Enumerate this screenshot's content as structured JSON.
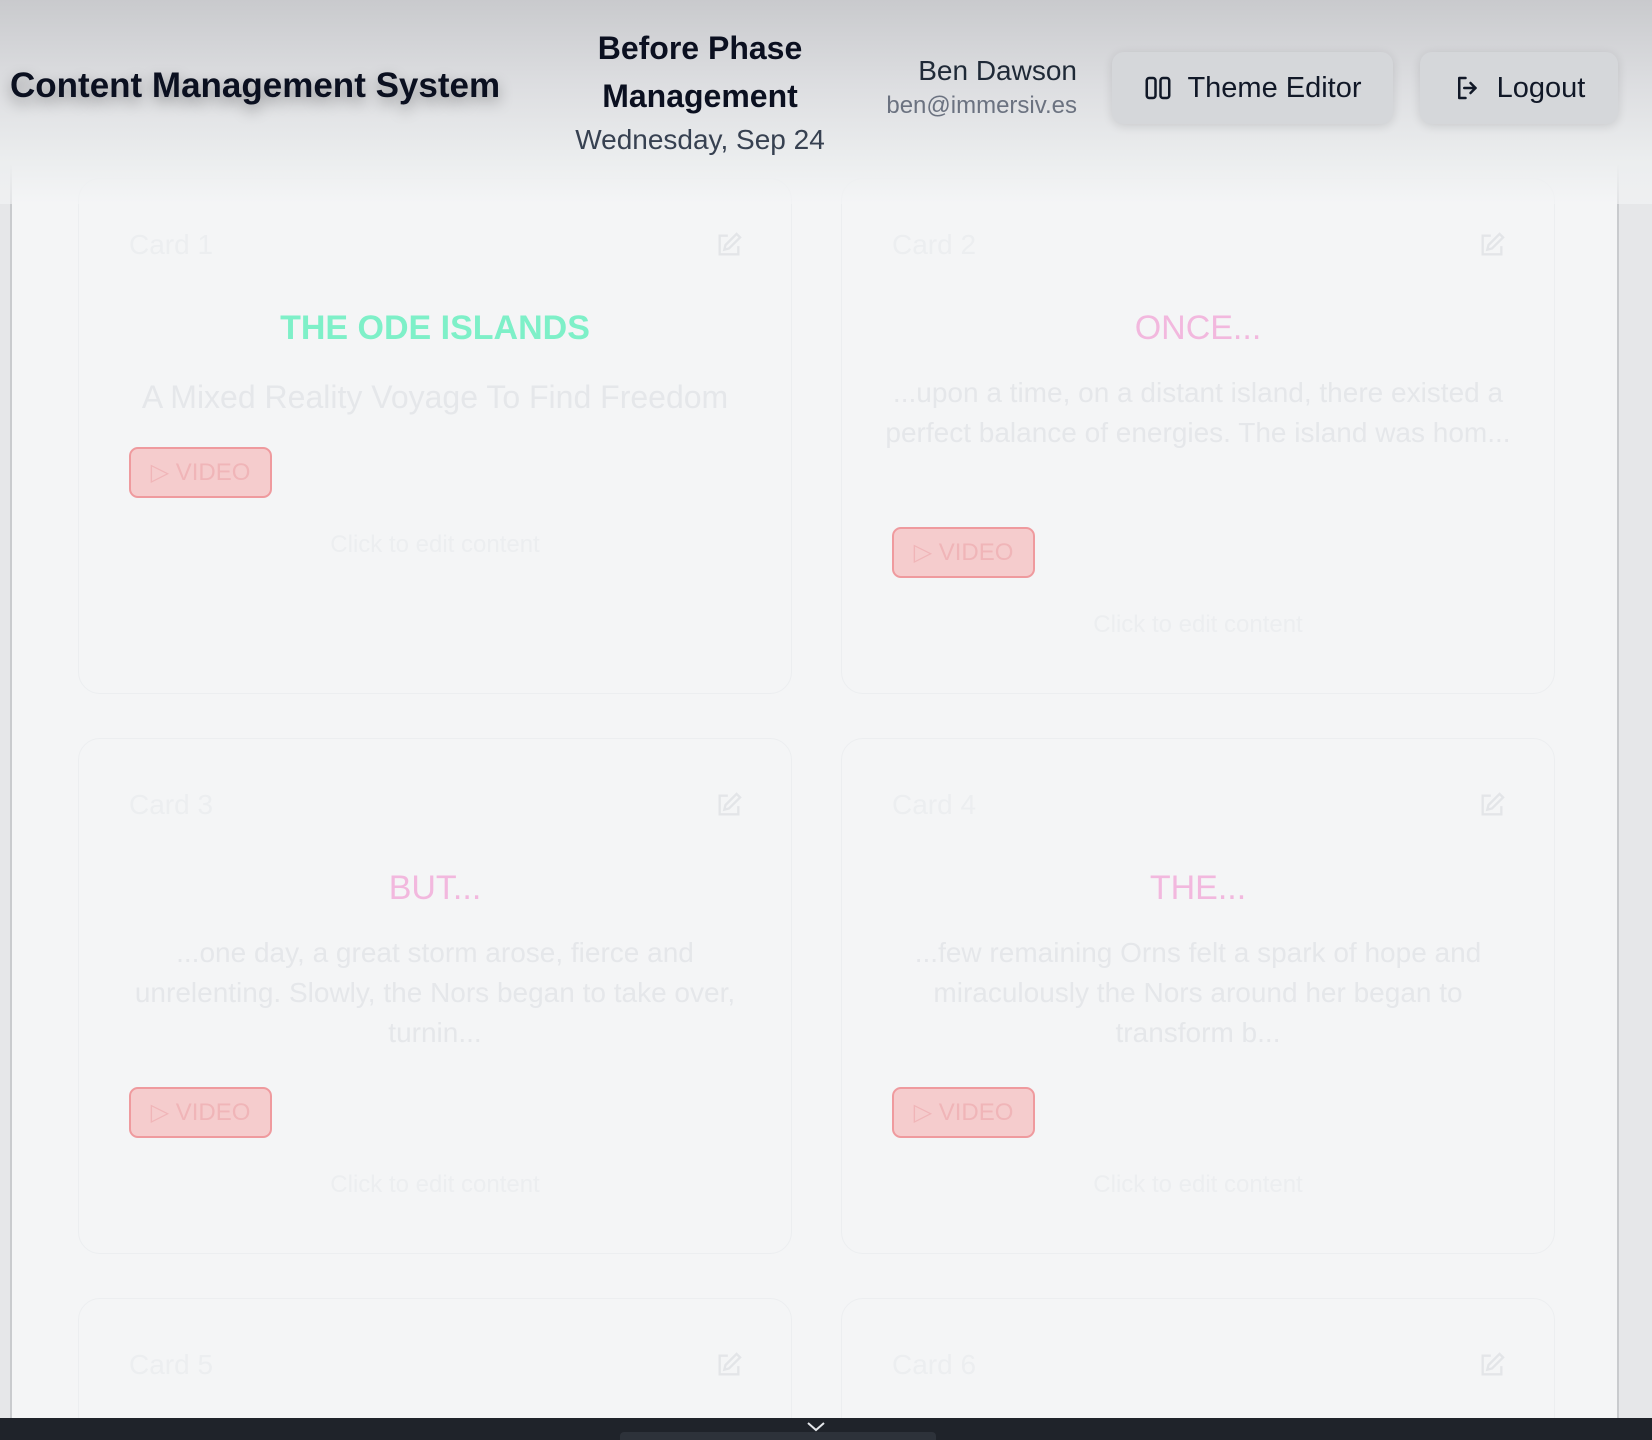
{
  "header": {
    "app_title": "Content Management System",
    "phase_title": "Before Phase Management",
    "date": "Wednesday, Sep 24",
    "user_name": "Ben Dawson",
    "user_email": "ben@immersiv.es",
    "theme_button": "Theme Editor",
    "logout_button": "Logout"
  },
  "cards": [
    {
      "label": "Card 1",
      "heading": "THE ODE ISLANDS",
      "heading_color": "#7ef0c8",
      "body": "A Mixed Reality Voyage To Find Freedom",
      "video_label": "▷ VIDEO",
      "hint": "Click to edit content"
    },
    {
      "label": "Card 2",
      "heading": "ONCE...",
      "heading_color": "#f2b8de",
      "body": "...upon a time, on a distant island, there existed a perfect balance of energies. The island was hom...",
      "video_label": "▷ VIDEO",
      "hint": "Click to edit content"
    },
    {
      "label": "Card 3",
      "heading": "BUT...",
      "heading_color": "#f2b8de",
      "body": "...one day, a great storm arose, fierce and unrelenting. Slowly, the Nors began to take over, turnin...",
      "video_label": "▷ VIDEO",
      "hint": "Click to edit content"
    },
    {
      "label": "Card 4",
      "heading": "THE...",
      "heading_color": "#f2b8de",
      "body": "...few remaining Orns felt a spark of hope and miraculously the Nors around her began to transform b...",
      "video_label": "▷ VIDEO",
      "hint": "Click to edit content"
    },
    {
      "label": "Card 5"
    },
    {
      "label": "Card 6"
    }
  ],
  "colors": {
    "video_badge_bg": "#f5cccd",
    "video_badge_border": "#ef9a9e"
  },
  "icons": {
    "theme": "columns-icon",
    "logout": "logout-icon",
    "edit": "edit-icon",
    "scroll": "chevron-down-icon"
  }
}
